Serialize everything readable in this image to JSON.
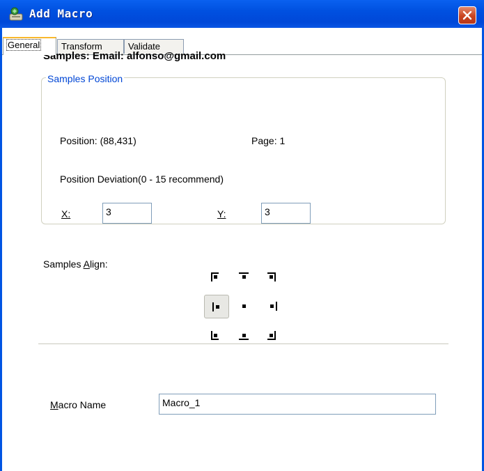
{
  "window": {
    "title": "Add Macro",
    "close_icon": "close-icon",
    "accent_color": "#0054e3",
    "close_color": "#c9431f"
  },
  "tabs": [
    {
      "label": "General",
      "mnemonic": "G",
      "active": true
    },
    {
      "label": "Transform",
      "mnemonic": "T",
      "active": false
    },
    {
      "label": "Validate",
      "mnemonic": "V",
      "active": false
    }
  ],
  "general": {
    "samples_heading": "Samples: Email: alfonso@gmail.com",
    "position_group": {
      "title": "Samples Position",
      "position_label": "Position: (88,431)",
      "page_label": "Page: 1",
      "deviation_label": "Position Deviation(0 - 15 recommend)",
      "x_label": "X:",
      "x_value": "3",
      "y_label": "Y:",
      "y_value": "3"
    },
    "align": {
      "label": "Samples Align:",
      "options": [
        "top-left",
        "top-center",
        "top-right",
        "middle-left",
        "center",
        "middle-right",
        "bottom-left",
        "bottom-center",
        "bottom-right"
      ],
      "selected": "middle-left"
    },
    "macro_name": {
      "label": "Macro Name",
      "value": "Macro_1"
    }
  }
}
